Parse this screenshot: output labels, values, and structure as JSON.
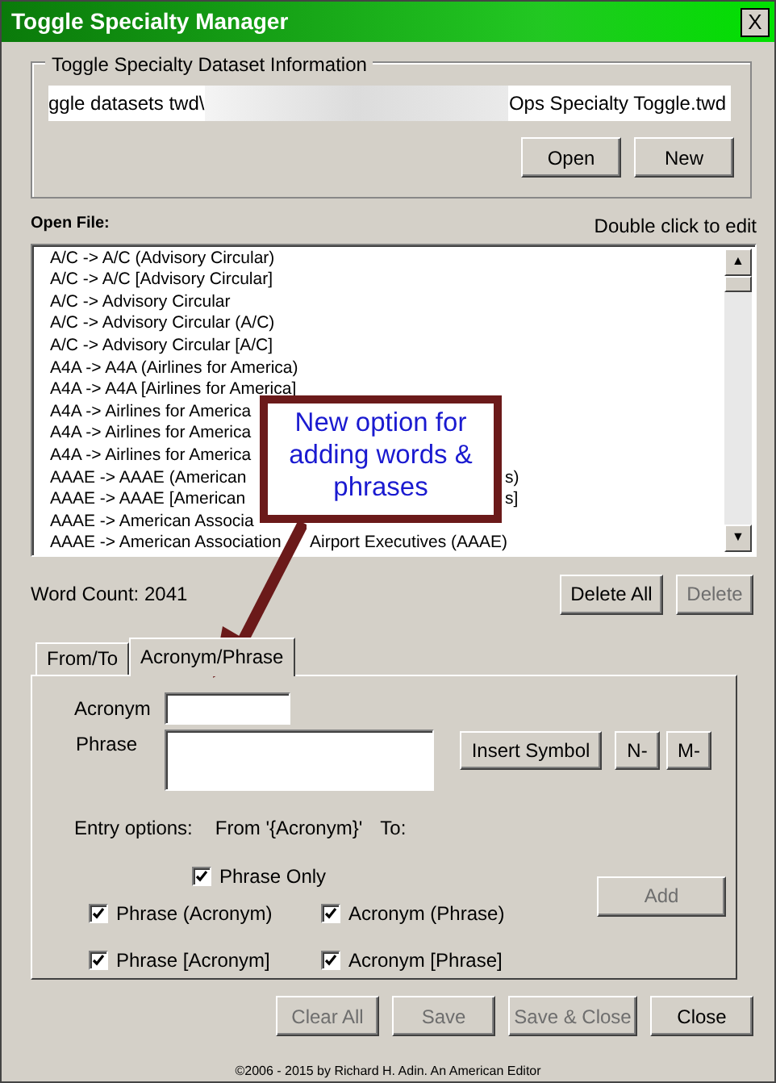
{
  "window": {
    "title": "Toggle Specialty Manager",
    "close": "X"
  },
  "dataset": {
    "legend": "Toggle Specialty Dataset Information",
    "path_start": "ggle datasets twd\\",
    "path_end": "Ops Specialty Toggle.twd",
    "buttons": [
      {
        "label": "Open",
        "disabled": false
      },
      {
        "label": "New",
        "disabled": false
      }
    ]
  },
  "open_file": {
    "label": "Open File:",
    "hint": "Double click to edit",
    "entries": [
      {
        "text": "A/C -> A/C (Advisory Circular)"
      },
      {
        "text": "A/C -> A/C [Advisory Circular]"
      },
      {
        "text": "A/C -> Advisory Circular"
      },
      {
        "text": "A/C -> Advisory Circular (A/C)"
      },
      {
        "text": "A/C -> Advisory Circular [A/C]"
      },
      {
        "text": "A4A -> A4A (Airlines for America)"
      },
      {
        "text": "A4A -> A4A [Airlines for America]"
      },
      {
        "text": "A4A -> Airlines for America"
      },
      {
        "text": "A4A -> Airlines for America"
      },
      {
        "text": "A4A -> Airlines for America"
      },
      {
        "text": "AAAE -> AAAE (American",
        "tail": "s)"
      },
      {
        "text": "AAAE -> AAAE [American",
        "tail": "s]"
      },
      {
        "text": "AAAE -> American Associa"
      },
      {
        "text": "AAAE -> American Association",
        "tail": "Airport Executives (AAAE)"
      }
    ],
    "scroll_up": "▲",
    "scroll_down": "▼"
  },
  "word_count": "Word Count: 2041",
  "list_buttons": [
    {
      "label": "Delete All",
      "disabled": false
    },
    {
      "label": "Delete",
      "disabled": true
    }
  ],
  "tabs": [
    {
      "label": "From/To",
      "selected": false
    },
    {
      "label": "Acronym/Phrase",
      "selected": true
    }
  ],
  "form": {
    "acronym_label": "Acronym",
    "phrase_label": "Phrase",
    "symbol_buttons": [
      {
        "label": "Insert Symbol",
        "disabled": false
      },
      {
        "label": "N-",
        "disabled": false
      },
      {
        "label": "M-",
        "disabled": false
      }
    ],
    "entry_label": "Entry options:",
    "from_label": "From '{Acronym}'",
    "to_label": "To:",
    "options": [
      {
        "label": "Phrase Only",
        "checked": true
      },
      {
        "label": "Phrase (Acronym)",
        "checked": true
      },
      {
        "label": "Acronym (Phrase)",
        "checked": true
      },
      {
        "label": "Phrase [Acronym]",
        "checked": true
      },
      {
        "label": "Acronym [Phrase]",
        "checked": true
      }
    ],
    "add_button": {
      "label": "Add",
      "disabled": true
    }
  },
  "bottom_buttons": [
    {
      "label": "Clear All",
      "disabled": true
    },
    {
      "label": "Save",
      "disabled": true
    },
    {
      "label": "Save & Close",
      "disabled": true
    },
    {
      "label": "Close",
      "disabled": false
    }
  ],
  "footer": "©2006 - 2015 by Richard H. Adin. An American Editor",
  "callout": {
    "text": "New option for adding words & phrases"
  }
}
